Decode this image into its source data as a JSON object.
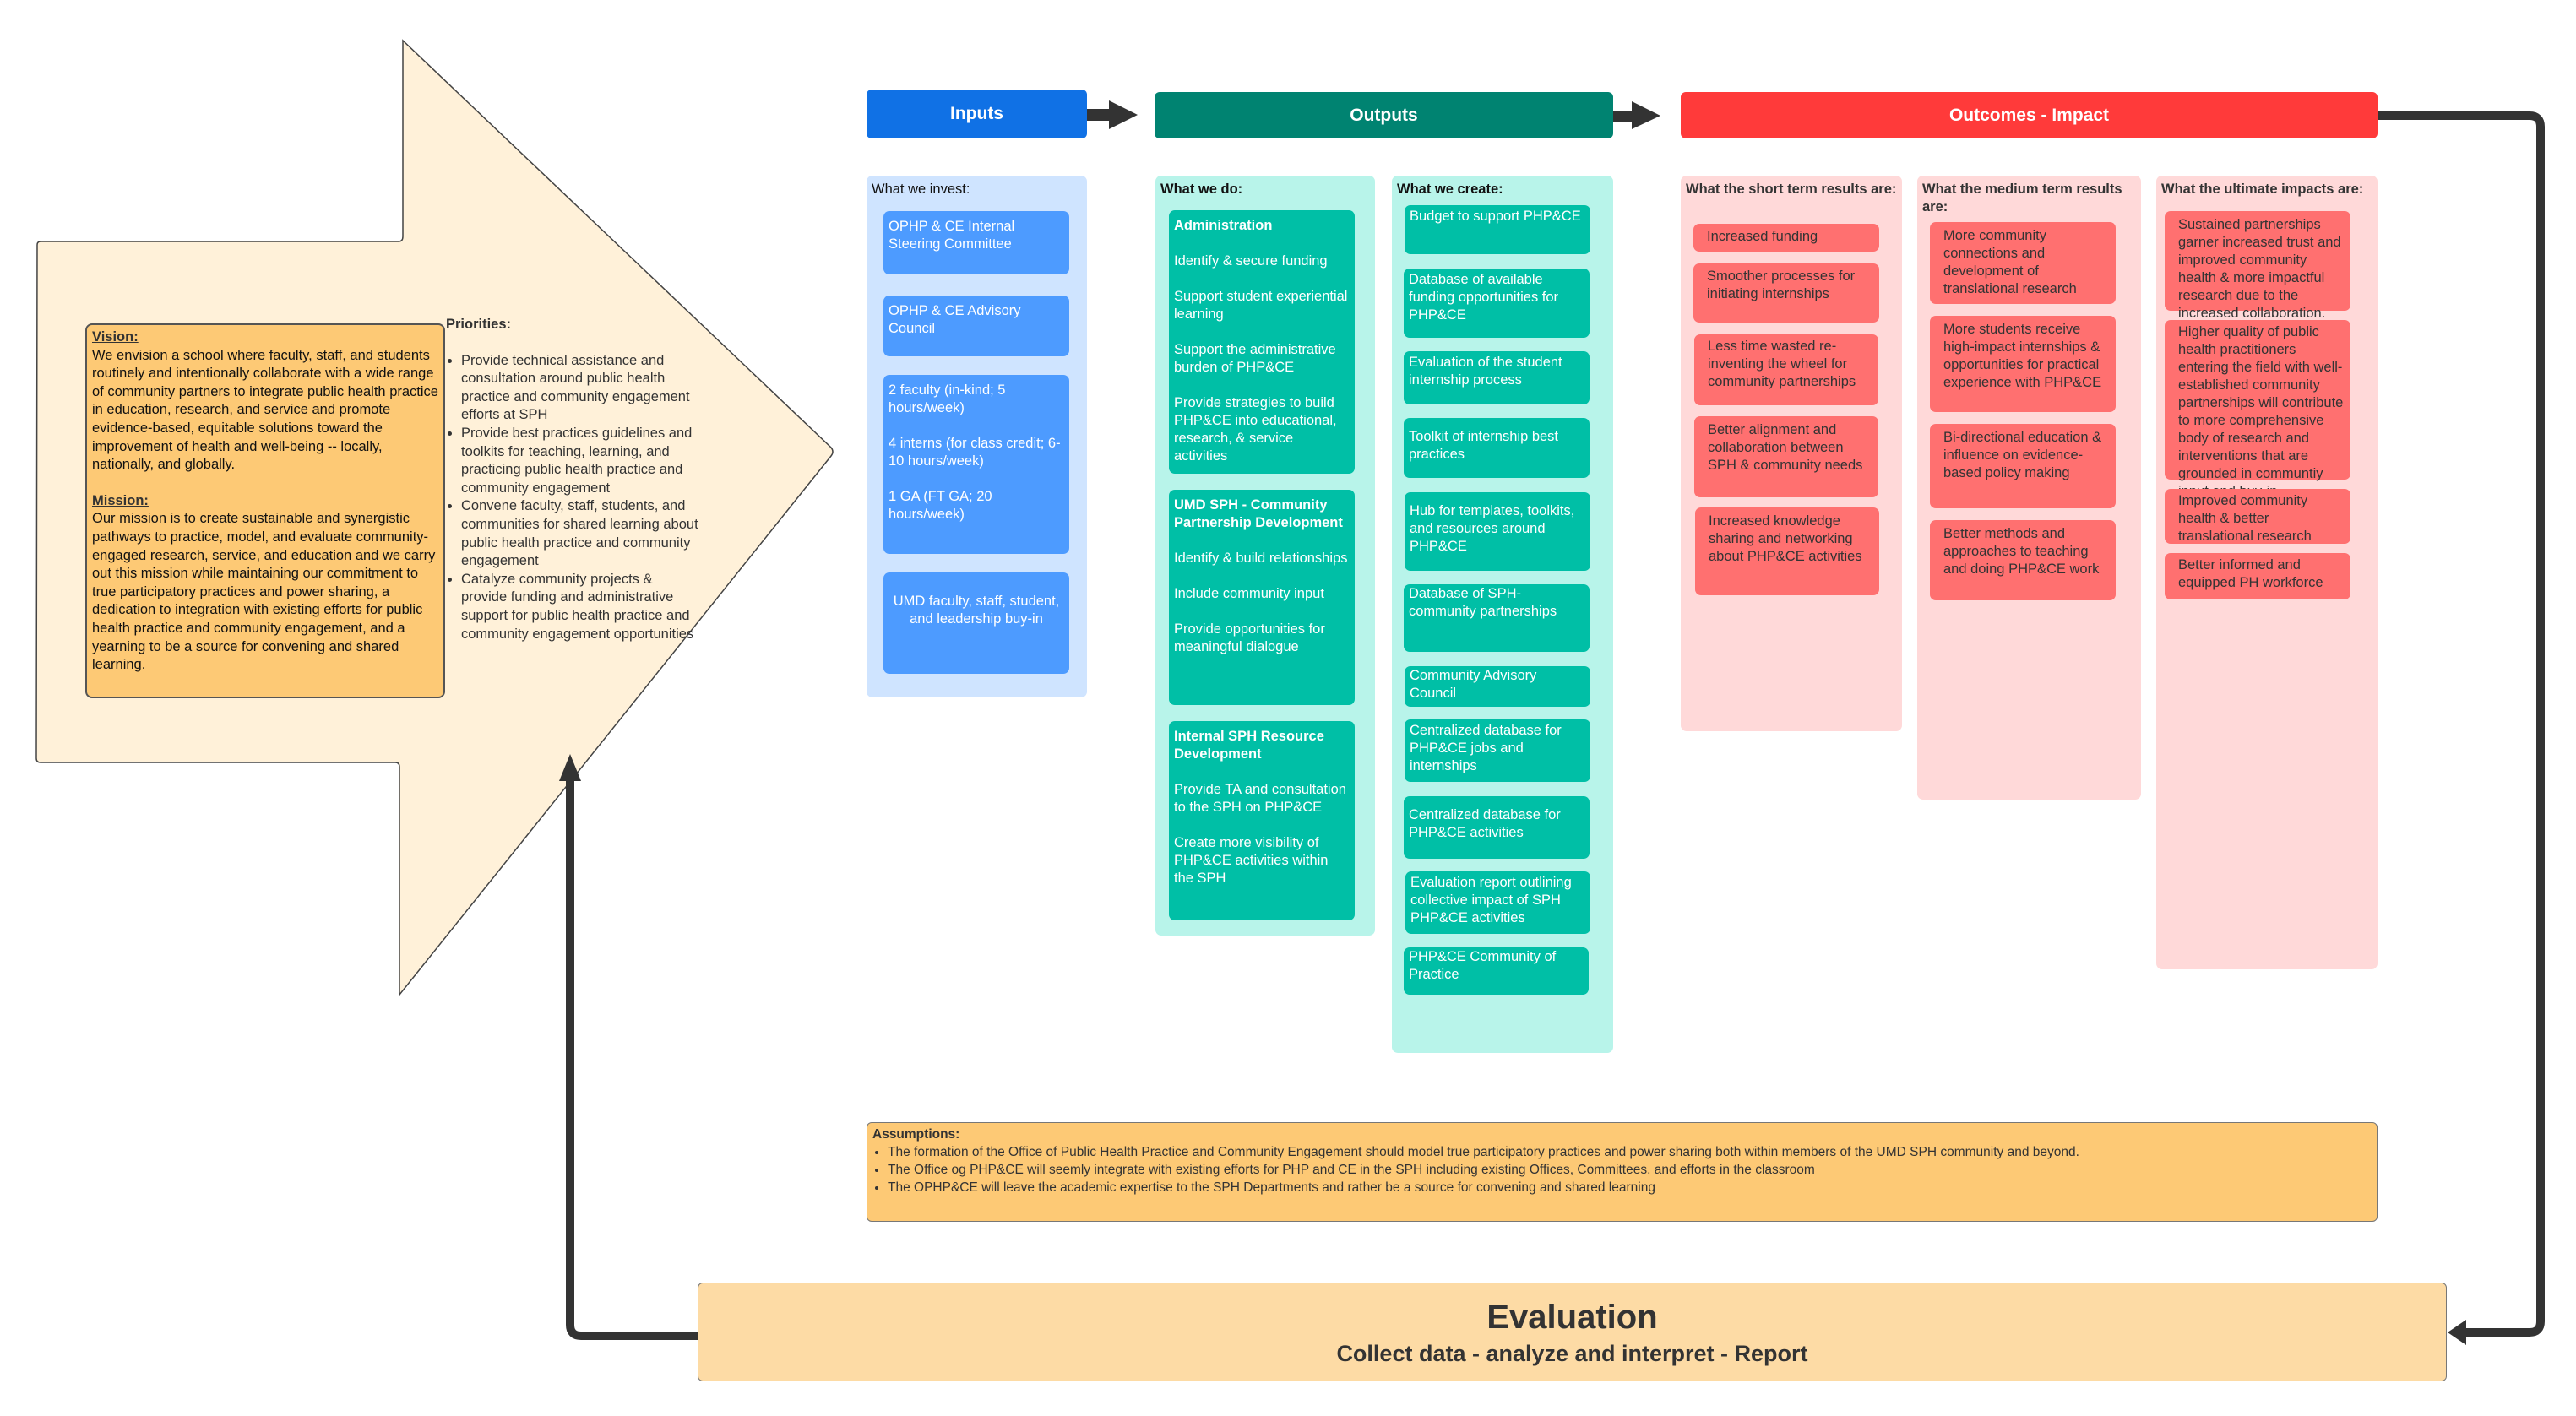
{
  "strategy": {
    "vision_heading": "Vision:",
    "vision_text": "We envision a school where faculty, staff, and students routinely and intentionally collaborate with a wide range of community partners to integrate public health practice in education, research, and service and promote evidence-based, equitable solutions toward the improvement of health and well-being -- locally, nationally, and globally.",
    "mission_heading": "Mission:",
    "mission_text": "Our mission is to create sustainable and synergistic pathways to practice, model, and evaluate community-engaged research, service, and education and we carry out this mission while maintaining our commitment to true participatory practices and power sharing, a dedication to integration with existing efforts for public health practice and community engagement, and a yearning to be a source for convening and shared learning.",
    "priorities_heading": "Priorities:",
    "priorities": [
      "Provide technical assistance and consultation around public health practice and community engagement efforts at SPH",
      "Provide best practices guidelines and toolkits for teaching, learning, and practicing public health practice and community engagement",
      "Convene faculty, staff, students, and communities for shared learning about public health practice and community engagement",
      "Catalyze community projects & provide funding and administrative support for public health practice and community engagement opportunities"
    ]
  },
  "headers": {
    "inputs": "Inputs",
    "outputs": "Outputs",
    "outcomes": "Outcomes - Impact"
  },
  "colors": {
    "inputs": "#1071e5",
    "outputs": "#008371",
    "outcomes": "#ff3a3a",
    "arrow": "#333333",
    "strategy_fill": "#fff1d9",
    "vision_fill": "#fdc975",
    "evaluation_fill": "#fddba5"
  },
  "inputs": {
    "title": "What we invest:",
    "items": [
      [
        "OPHP & CE  Internal Steering Committee"
      ],
      [
        "OPHP & CE Advisory Council"
      ],
      [
        "2 faculty (in-kind; 5 hours/week)",
        "4 interns (for class credit; 6-10 hours/week)",
        "1 GA (FT GA; 20 hours/week)"
      ],
      [
        "UMD faculty, staff, student, and leadership buy-in"
      ]
    ]
  },
  "do": {
    "title": "What we do:",
    "groups": [
      {
        "heading": "Administration",
        "items": [
          "Identify & secure funding",
          "Support student experiential learning",
          "Support the administrative burden of PHP&CE",
          "Provide strategies to build PHP&CE into educational, research, & service activities"
        ]
      },
      {
        "heading": "UMD SPH - Community Partnership Development",
        "items": [
          "Identify & build relationships",
          "Include community input",
          "Provide opportunities for meaningful dialogue"
        ]
      },
      {
        "heading": "Internal SPH Resource Development",
        "items": [
          "Provide TA and consultation to the SPH on PHP&CE",
          "Create more visibility of PHP&CE activities within the SPH"
        ]
      }
    ]
  },
  "create": {
    "title": "What we create:",
    "items": [
      "Budget to support PHP&CE",
      "Database of available funding opportunities for PHP&CE",
      "Evaluation of the student internship process",
      "Toolkit of internship best practices",
      "Hub for templates, toolkits, and resources around PHP&CE",
      "Database of SPH-community partnerships",
      "Community Advisory Council",
      "Centralized database for PHP&CE jobs and internships",
      "Centralized database for PHP&CE activities",
      "Evaluation report outlining collective impact of SPH PHP&CE activities",
      "PHP&CE Community of Practice"
    ]
  },
  "short_term": {
    "title": "What the short term results are:",
    "items": [
      "Increased funding",
      "Smoother processes for initiating internships",
      "Less time wasted re-inventing the wheel for community partnerships",
      "Better alignment and collaboration between SPH & community needs",
      "Increased knowledge sharing and networking about PHP&CE activities"
    ]
  },
  "medium_term": {
    "title": "What the medium term results are:",
    "items": [
      "More community connections and development of translational research",
      "More students receive high-impact internships & opportunities for practical experience with PHP&CE",
      "Bi-directional education & influence on evidence-based policy making",
      "Better methods and approaches to teaching and doing PHP&CE work"
    ]
  },
  "ultimate": {
    "title": "What the ultimate impacts are:",
    "items": [
      "Sustained partnerships garner increased trust and improved community health & more impactful research due to the increased collaboration.",
      "Higher quality of public health practitioners entering the field with well-established community partnerships will contribute to more comprehensive body of research and interventions that are grounded in communtiy input and buy-in",
      "Improved community health & better translational research",
      "Better informed and equipped PH workforce"
    ]
  },
  "assumptions": {
    "heading": "Assumptions:",
    "items": [
      "The formation of the Office of Public Health Practice and Community Engagement should model true participatory practices and power sharing both within members of the UMD SPH community and beyond.",
      "The Office og PHP&CE will seemly integrate with existing efforts for PHP and CE in the SPH including existing Offices, Committees, and efforts in the classroom",
      "The OPHP&CE will leave the academic expertise to the SPH Departments and rather be a source for convening and shared learning"
    ]
  },
  "evaluation": {
    "title": "Evaluation",
    "subtitle": "Collect data - analyze and interpret - Report"
  }
}
